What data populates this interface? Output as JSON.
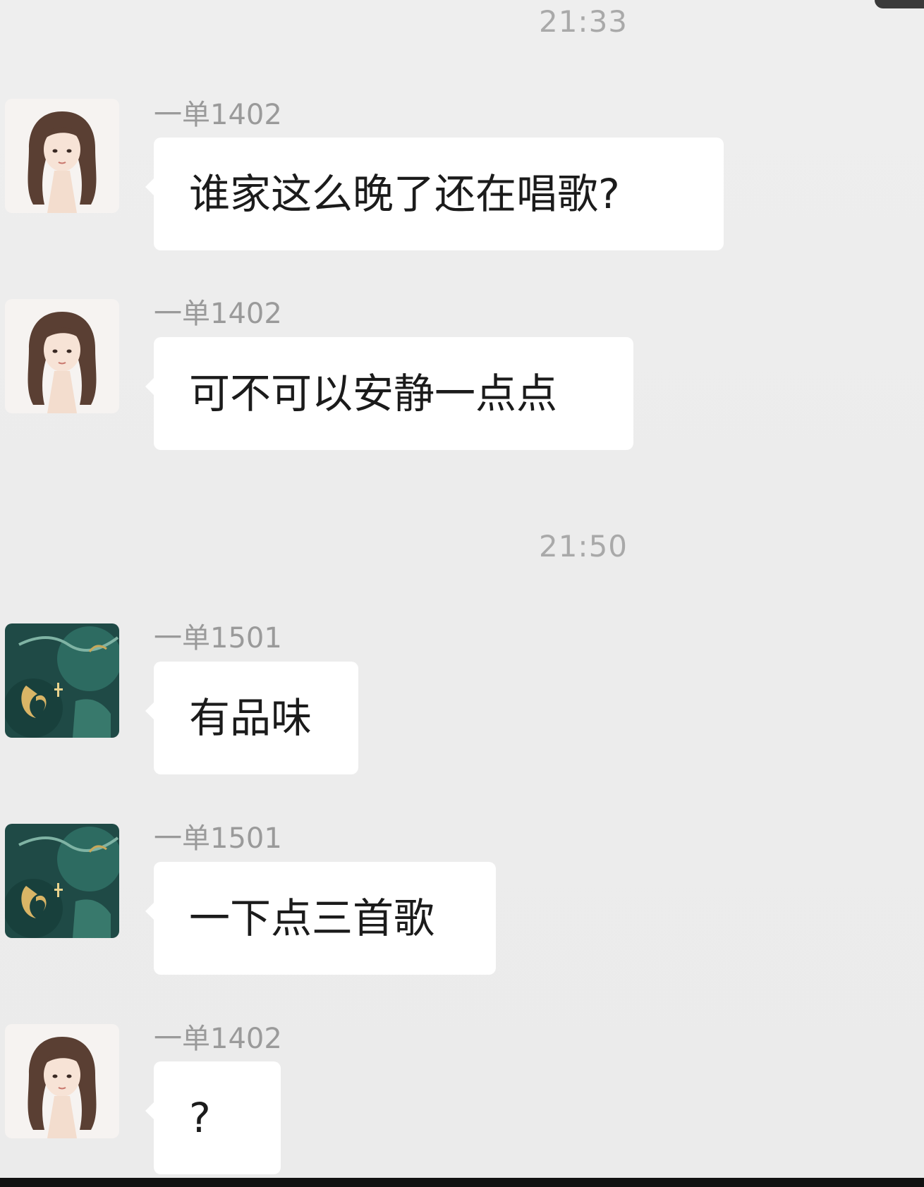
{
  "messages_area": {
    "time_1": "21:33",
    "time_2": "21:50",
    "messages": [
      {
        "sender": "一单1402",
        "text": "谁家这么晚了还在唱歌?",
        "avatar": "girl-avatar"
      },
      {
        "sender": "一单1402",
        "text": "可不可以安静一点点",
        "avatar": "girl-avatar"
      },
      {
        "sender": "一单1501",
        "text": "有品味",
        "avatar": "green-art-avatar"
      },
      {
        "sender": "一单1501",
        "text": "一下点三首歌",
        "avatar": "green-art-avatar"
      },
      {
        "sender": "一单1402",
        "text": "?",
        "avatar": "girl-avatar"
      }
    ]
  },
  "colors": {
    "background": "#ededed",
    "bubble": "#ffffff",
    "meta_text": "#a9a9a9"
  }
}
